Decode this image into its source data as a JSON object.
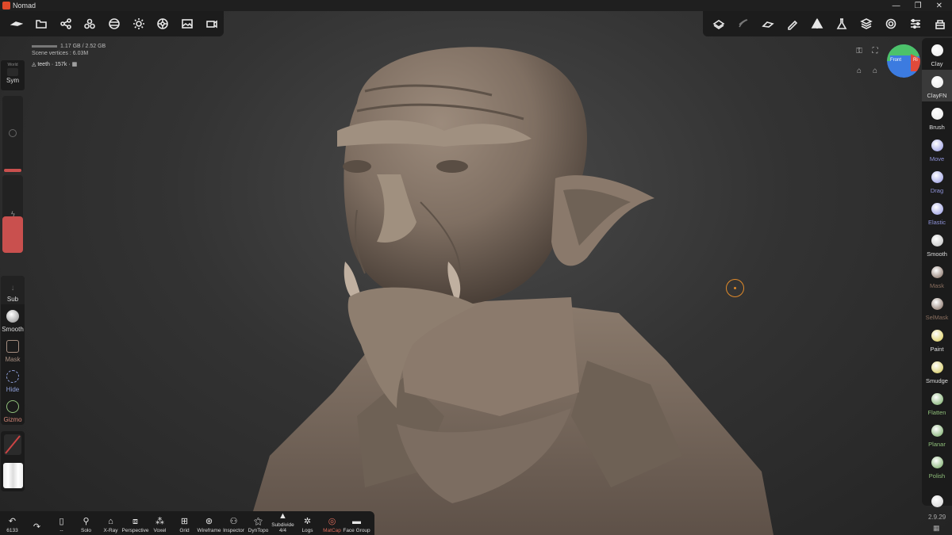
{
  "window": {
    "title": "Nomad",
    "controls": [
      "—",
      "❐",
      "✕"
    ]
  },
  "top_left_toolbar": [
    {
      "name": "menu-icon",
      "glyph": "☰"
    },
    {
      "name": "folder-icon",
      "glyph": "📁"
    },
    {
      "name": "scene-graph-icon",
      "glyph": "⚲"
    },
    {
      "name": "primitives-icon",
      "glyph": "⁂"
    },
    {
      "name": "material-icon",
      "glyph": "◍"
    },
    {
      "name": "light-icon",
      "glyph": "☼"
    },
    {
      "name": "postprocess-icon",
      "glyph": "✺"
    },
    {
      "name": "background-icon",
      "glyph": "▣"
    },
    {
      "name": "camera-icon",
      "glyph": "▭"
    }
  ],
  "top_right_toolbar": [
    {
      "name": "topology-icon"
    },
    {
      "name": "stroke-icon"
    },
    {
      "name": "tool-settings-icon"
    },
    {
      "name": "painting-icon"
    },
    {
      "name": "symmetry-icon"
    },
    {
      "name": "lab-icon"
    },
    {
      "name": "layers-icon"
    },
    {
      "name": "settings-icon"
    },
    {
      "name": "interface-icon"
    },
    {
      "name": "plugins-icon"
    }
  ],
  "memory": {
    "usage": "1.17 GB / 2.52 GB",
    "scene_vertices": "Scene vertices : 6.03M"
  },
  "mesh": {
    "label": "teeth",
    "count": "· 157k ·"
  },
  "symmetry": {
    "world_label": "World",
    "label": "Sym"
  },
  "left_tools": [
    {
      "label": "Sub",
      "name": "sub-tool"
    },
    {
      "label": "Smooth",
      "name": "smooth-tool"
    },
    {
      "label": "Mask",
      "name": "mask-tool"
    },
    {
      "label": "Hide",
      "name": "hide-tool"
    },
    {
      "label": "Gizmo",
      "name": "gizmo-tool"
    }
  ],
  "right_tools": [
    {
      "label": "Clay",
      "name": "clay-tool",
      "style": "",
      "color": "#e8e8e8"
    },
    {
      "label": "ClayFN",
      "name": "clayfn-tool",
      "style": "active",
      "color": "#e8e8e8"
    },
    {
      "label": "Brush",
      "name": "brush-tool",
      "style": "",
      "color": "#e8e8e8"
    },
    {
      "label": "Move",
      "name": "move-tool",
      "style": "blue",
      "color": "#8f93e0"
    },
    {
      "label": "Drag",
      "name": "drag-tool",
      "style": "blue",
      "color": "#8f93e0"
    },
    {
      "label": "Elastic",
      "name": "elastic-tool",
      "style": "blue",
      "color": "#8f93e0"
    },
    {
      "label": "Smooth",
      "name": "smooth-right-tool",
      "style": "",
      "color": "#bbbbbb"
    },
    {
      "label": "Mask",
      "name": "mask-right-tool",
      "style": "dim",
      "color": "#7a6255"
    },
    {
      "label": "SelMask",
      "name": "selmask-tool",
      "style": "dim",
      "color": "#7a6255"
    },
    {
      "label": "Paint",
      "name": "paint-tool",
      "style": "",
      "color": "#d8c74a"
    },
    {
      "label": "Smudge",
      "name": "smudge-tool",
      "style": "",
      "color": "#cfc24a"
    },
    {
      "label": "Flatten",
      "name": "flatten-tool",
      "style": "green",
      "color": "#6fa55c"
    },
    {
      "label": "Planar",
      "name": "planar-tool",
      "style": "green",
      "color": "#6fa55c"
    },
    {
      "label": "Polish",
      "name": "polish-tool",
      "style": "green",
      "color": "#6fa55c"
    },
    {
      "label": "",
      "name": "more-tool",
      "style": "",
      "color": "#cfcfcf"
    }
  ],
  "viewcube": {
    "front": "Front",
    "right": "Ri"
  },
  "bottom_toolbar": [
    {
      "label": "6133",
      "name": "undo-button",
      "glyph": "↶",
      "style": ""
    },
    {
      "label": "",
      "name": "redo-button",
      "glyph": "↷",
      "style": ""
    },
    {
      "label": "--",
      "name": "stats-button",
      "glyph": "▯",
      "style": ""
    },
    {
      "label": "Solo",
      "name": "solo-button",
      "glyph": "⚲",
      "style": ""
    },
    {
      "label": "X-Ray",
      "name": "xray-button",
      "glyph": "⌂",
      "style": ""
    },
    {
      "label": "Perspective",
      "name": "perspective-button",
      "glyph": "⧈",
      "style": ""
    },
    {
      "label": "Voxel",
      "name": "voxel-button",
      "glyph": "⁂",
      "style": ""
    },
    {
      "label": "Grid",
      "name": "grid-button",
      "glyph": "⊞",
      "style": ""
    },
    {
      "label": "Wireframe",
      "name": "wireframe-button",
      "glyph": "⊛",
      "style": ""
    },
    {
      "label": "Inspector",
      "name": "inspector-button",
      "glyph": "⚇",
      "style": ""
    },
    {
      "label": "DynTopo",
      "name": "dyntopo-button",
      "glyph": "⚝",
      "style": ""
    },
    {
      "label": "Subdivide\n4/4",
      "name": "subdivide-button",
      "glyph": "▲",
      "style": ""
    },
    {
      "label": "Logs",
      "name": "logs-button",
      "glyph": "✲",
      "style": ""
    },
    {
      "label": "MatCap",
      "name": "matcap-button",
      "glyph": "◎",
      "style": "red"
    },
    {
      "label": "Face Group",
      "name": "face-group-button",
      "glyph": "▬",
      "style": ""
    }
  ],
  "version": "2.9.29"
}
